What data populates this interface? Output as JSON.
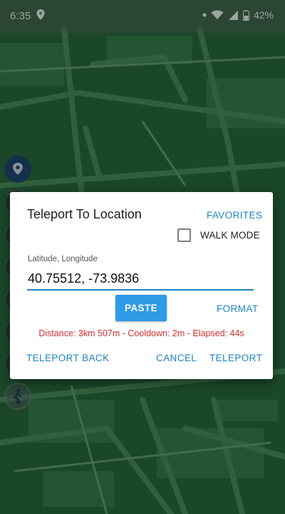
{
  "status_bar": {
    "time": "6:35",
    "battery": "42%",
    "icons": [
      "location-pin-icon",
      "notification-dot-icon",
      "wifi-icon",
      "signal-icon",
      "battery-icon"
    ]
  },
  "dialog": {
    "title": "Teleport To Location",
    "favorites_label": "FAVORITES",
    "walk_mode_label": "WALK MODE",
    "walk_mode_checked": false,
    "field_label": "Latitude, Longitude",
    "coordinates_value": "40.75512, -73.9836",
    "paste_label": "PASTE",
    "format_label": "FORMAT",
    "status_text": "Distance: 3km 507m - Cooldown: 2m - Elapsed: 44s",
    "teleport_back_label": "TELEPORT BACK",
    "cancel_label": "CANCEL",
    "teleport_label": "TELEPORT"
  },
  "colors": {
    "accent": "#1f85bf",
    "paste_button": "#2f9ae6",
    "status_error": "#d42f2f",
    "map_green": "#1e5b33"
  }
}
